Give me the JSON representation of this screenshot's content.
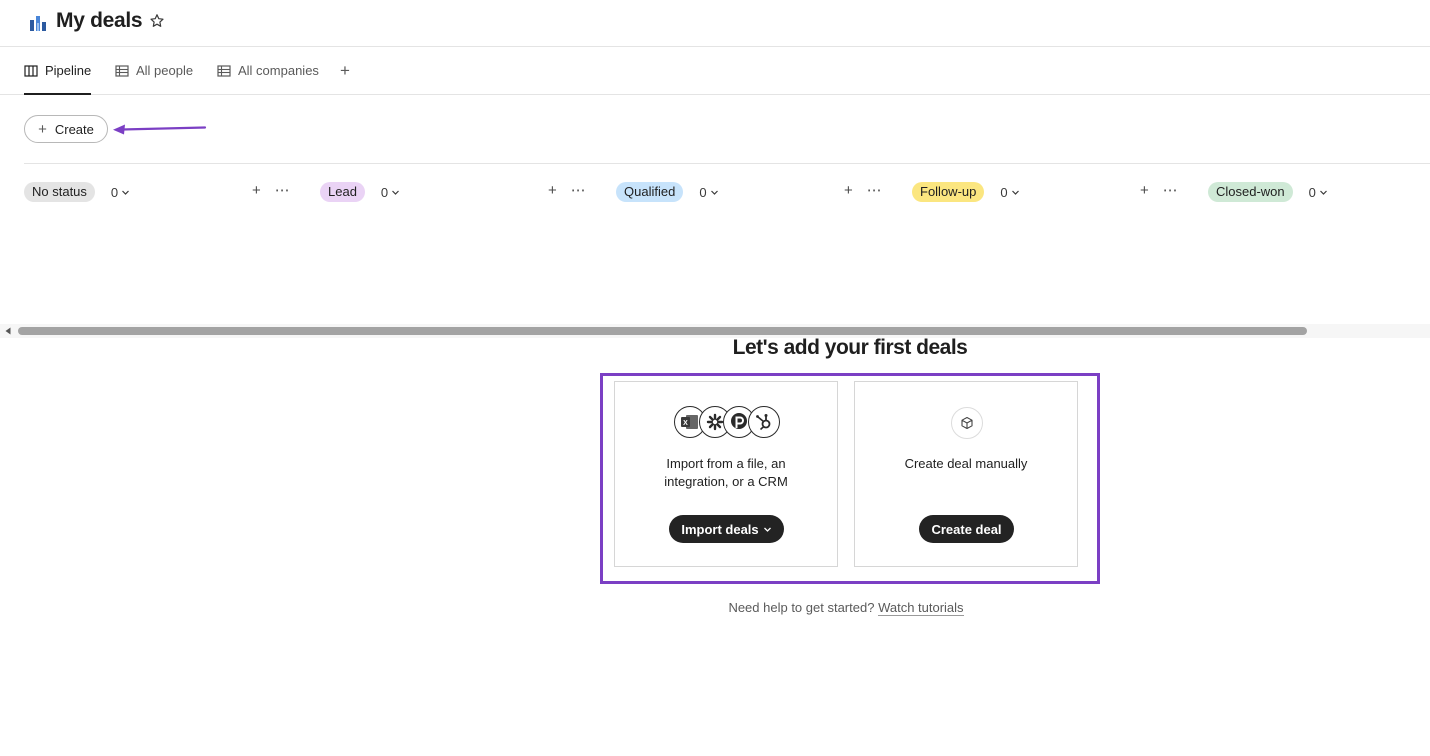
{
  "header": {
    "title": "My deals",
    "icon": "pipeline-chart-icon"
  },
  "tabs": [
    {
      "label": "Pipeline",
      "icon": "board-columns-icon",
      "active": true
    },
    {
      "label": "All people",
      "icon": "table-icon",
      "active": false
    },
    {
      "label": "All companies",
      "icon": "table-icon",
      "active": false
    }
  ],
  "tab_add_label": "+",
  "toolbar": {
    "create_label": "Create"
  },
  "columns": [
    {
      "status": "No status",
      "count": "0",
      "color": "#e4e4e4"
    },
    {
      "status": "Lead",
      "count": "0",
      "color": "#ead3f5"
    },
    {
      "status": "Qualified",
      "count": "0",
      "color": "#c7e3fb"
    },
    {
      "status": "Follow-up",
      "count": "0",
      "color": "#fbe680"
    },
    {
      "status": "Closed-won",
      "count": "0",
      "color": "#cfe9d6"
    }
  ],
  "empty_state": {
    "title": "Let's add your first deals",
    "import_card": {
      "text_line1": "Import from a file, an",
      "text_line2": "integration, or a CRM",
      "button_label": "Import deals",
      "logos": [
        "excel-icon",
        "zapier-icon",
        "pipedrive-icon",
        "hubspot-icon"
      ]
    },
    "manual_card": {
      "text": "Create deal manually",
      "button_label": "Create deal",
      "icon": "cube-icon"
    },
    "help_text": "Need help to get started?",
    "help_link": "Watch tutorials"
  },
  "colors": {
    "annotation": "#7b3fc4",
    "primary_button": "#232323"
  }
}
